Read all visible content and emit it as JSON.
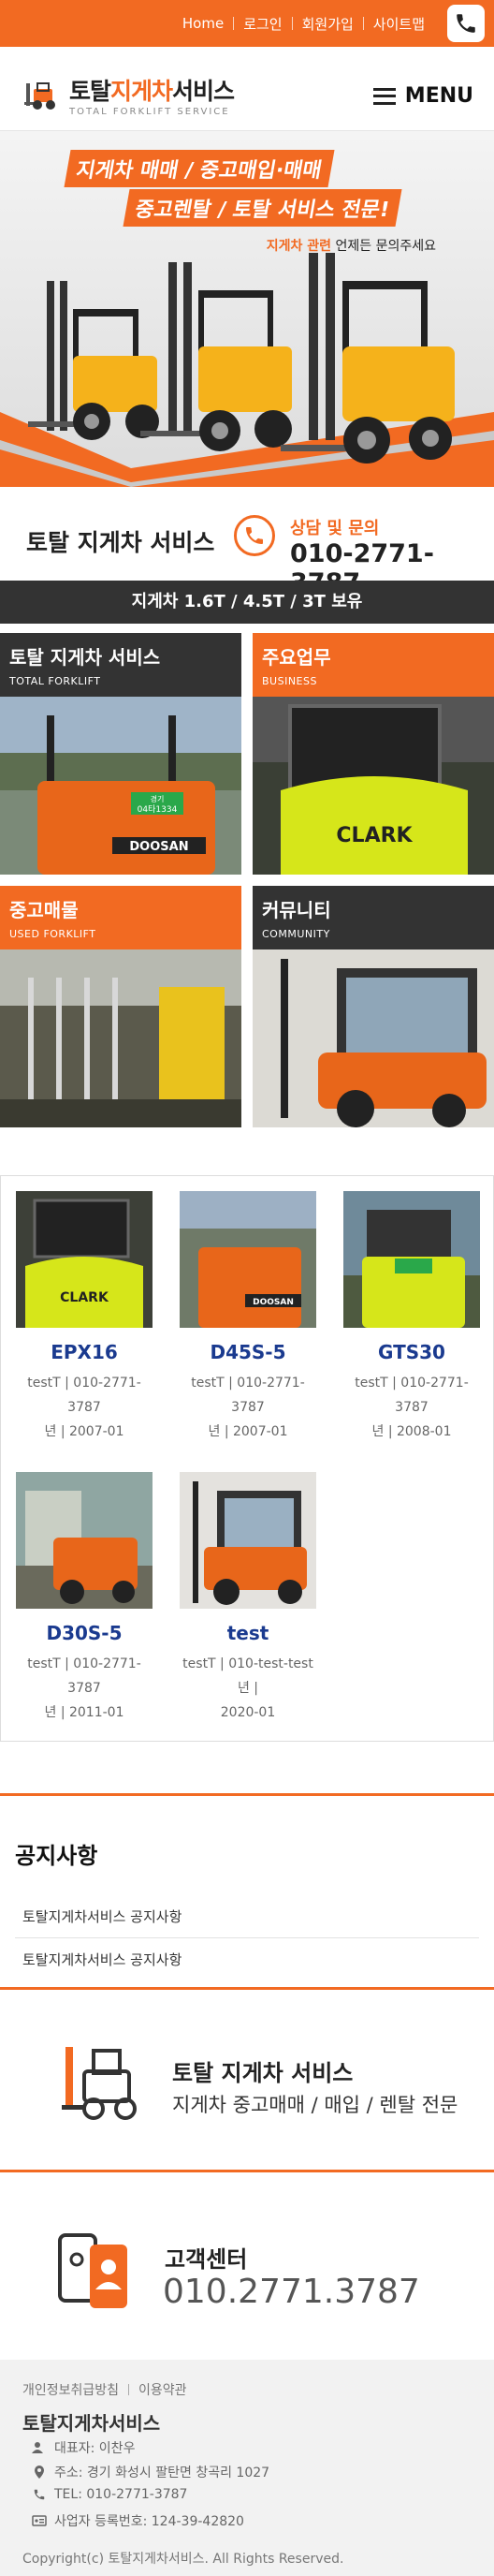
{
  "topbar": {
    "links": [
      "Home",
      "로그인",
      "회원가입",
      "사이트맵"
    ]
  },
  "header": {
    "logo_main_a": "토탈",
    "logo_main_b": "지게차",
    "logo_main_c": "서비스",
    "logo_sub": "TOTAL FORKLIFT SERVICE",
    "menu_label": "MENU"
  },
  "hero": {
    "line1": "지게차 매매 / 중고매입·매매",
    "line2": "중고렌탈 / 토탈 서비스 전문!",
    "note_highlight": "지게차 관련",
    "note_rest": " 언제든 문의주세요"
  },
  "contact": {
    "title": "토탈 지게차 서비스",
    "label": "상담 및 문의",
    "number": "010-2771-3787"
  },
  "stock_bar": "지게차 1.6T / 4.5T / 3T 보유",
  "tiles": [
    {
      "title": "토탈 지게차 서비스",
      "sub": "TOTAL FORKLIFT"
    },
    {
      "title": "주요업무",
      "sub": "BUSINESS"
    },
    {
      "title": "중고매물",
      "sub": "USED FORKLIFT"
    },
    {
      "title": "커뮤니티",
      "sub": "COMMUNITY"
    }
  ],
  "tile_plates": {
    "doosan": "DOOSAN",
    "clark": "CLARK",
    "plate1": "경기",
    "plate2": "04타1334"
  },
  "products": [
    {
      "name": "EPX16",
      "meta1": "testT | 010-2771-3787",
      "meta2": "년 | 2007-01"
    },
    {
      "name": "D45S-5",
      "meta1": "testT | 010-2771-3787",
      "meta2": "년 | 2007-01"
    },
    {
      "name": "GTS30",
      "meta1": "testT | 010-2771-3787",
      "meta2": "년 | 2008-01"
    },
    {
      "name": "D30S-5",
      "meta1": "testT | 010-2771-3787",
      "meta2": "년 | 2011-01"
    },
    {
      "name": "test",
      "meta1": "testT | 010-test-test년 |",
      "meta2": "2020-01"
    }
  ],
  "notice": {
    "title": "공지사항",
    "items": [
      "토탈지게차서비스 공지사항",
      "토탈지게차서비스 공지사항"
    ]
  },
  "banner1": {
    "title": "토탈 지게차 서비스",
    "sub": "지게차 중고매매 / 매입 / 렌탈 전문"
  },
  "banner2": {
    "title": "고객센터",
    "number": "010.2771.3787"
  },
  "footer": {
    "link1": "개인정보취급방침",
    "link2": "이용약관",
    "name": "토탈지게차서비스",
    "ceo": "대표자: 이찬우",
    "address": "주소: 경기 화성시 팔탄면 창곡리 1027",
    "tel": "TEL: 010-2771-3787",
    "biz": "사업자 등록번호: 124-39-42820",
    "copyright": "Copyright(c) 토탈지게차서비스. All Rights Reserved."
  },
  "colors": {
    "accent": "#f26a22",
    "dark": "#333333",
    "product_name": "#1a3a8f"
  }
}
